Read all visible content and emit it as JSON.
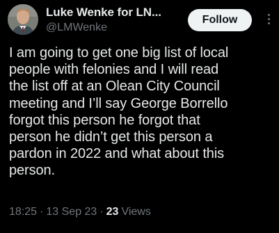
{
  "author": {
    "display_name": "Luke Wenke for LN...",
    "handle": "@LMWenke",
    "avatar_icon": "profile-photo"
  },
  "actions": {
    "follow_label": "Follow",
    "more_icon": "more-vertical-icon"
  },
  "tweet": {
    "text": "I am going to get one big list of local\npeople with felonies and I will read\nthe list off at an Olean City Council\nmeeting and I’ll say George Borrello\nforgot this person he forgot that\nperson he didn’t get this person a\npardon in 2022 and what about this\nperson.",
    "time": "18:25",
    "date": "13 Sep 23",
    "separator": "·",
    "views_count": "23",
    "views_label": "Views"
  },
  "colors": {
    "background": "#000000",
    "primary_text": "#e7e9ea",
    "secondary_text": "#71767b",
    "follow_bg": "#eff3f4",
    "follow_text": "#0f1419"
  }
}
